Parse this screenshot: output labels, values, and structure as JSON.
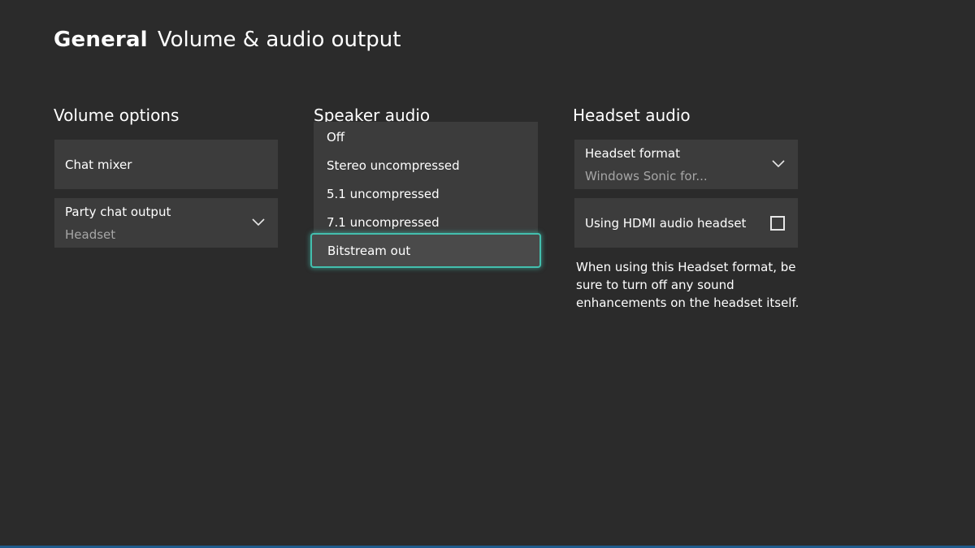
{
  "header": {
    "section": "General",
    "page": "Volume & audio output"
  },
  "volume": {
    "title": "Volume options",
    "chat_mixer": "Chat mixer",
    "party_chat": {
      "label": "Party chat output",
      "value": "Headset"
    }
  },
  "speaker": {
    "title": "Speaker audio",
    "options": [
      "Off",
      "Stereo uncompressed",
      "5.1 uncompressed",
      "7.1 uncompressed",
      "Bitstream out"
    ],
    "focused_index": 4
  },
  "headset": {
    "title": "Headset audio",
    "format": {
      "label": "Headset format",
      "value": "Windows Sonic for..."
    },
    "hdmi": {
      "label": "Using HDMI audio headset",
      "checked": false
    },
    "note": "When using this Headset format, be sure to turn off any sound enhancements on the headset itself."
  },
  "colors": {
    "background": "#2b2b2b",
    "tile": "#3c3c3c",
    "focus_accent": "#43bfae",
    "secondary_text": "#a6a6a6"
  },
  "icons": {
    "dropdown": "chevron-down-icon",
    "checkbox": "checkbox-unchecked-icon"
  }
}
